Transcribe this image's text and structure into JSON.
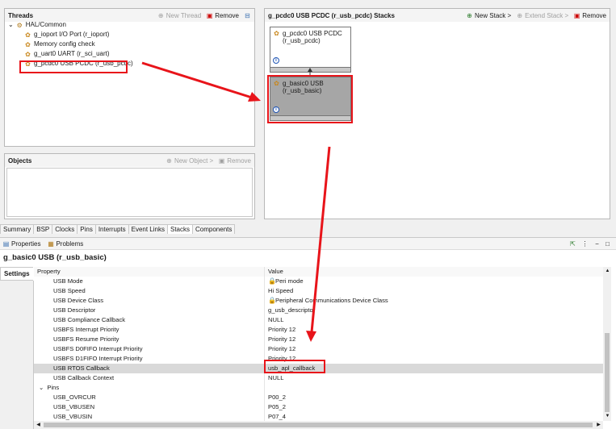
{
  "threads": {
    "title": "Threads",
    "new_thread": "New Thread",
    "remove": "Remove",
    "root": "HAL/Common",
    "items": [
      {
        "label": "g_ioport I/O Port (r_ioport)"
      },
      {
        "label": "Memory config check"
      },
      {
        "label": "g_uart0 UART (r_sci_uart)"
      },
      {
        "label": "g_pcdc0 USB PCDC (r_usb_pcdc)"
      }
    ]
  },
  "objects": {
    "title": "Objects",
    "new_object": "New Object >",
    "remove": "Remove"
  },
  "stacks": {
    "title": "g_pcdc0 USB PCDC (r_usb_pcdc) Stacks",
    "new_stack": "New Stack >",
    "extend_stack": "Extend Stack >",
    "remove": "Remove",
    "box1": {
      "line1": "g_pcdc0 USB PCDC",
      "line2": "(r_usb_pcdc)"
    },
    "box2": {
      "line1": "g_basic0 USB",
      "line2": "(r_usb_basic)"
    }
  },
  "tabs": [
    "Summary",
    "BSP",
    "Clocks",
    "Pins",
    "Interrupts",
    "Event Links",
    "Stacks",
    "Components"
  ],
  "active_tab": "Stacks",
  "bottom": {
    "properties_tab": "Properties",
    "problems_tab": "Problems",
    "title": "g_basic0 USB (r_usb_basic)",
    "settings_tab": "Settings",
    "col_property": "Property",
    "col_value": "Value",
    "rows": [
      {
        "name": "USB Mode",
        "value": "Peri mode",
        "lock": true
      },
      {
        "name": "USB Speed",
        "value": "Hi Speed"
      },
      {
        "name": "USB Device Class",
        "value": "Peripheral Communications Device Class",
        "lock": true
      },
      {
        "name": "USB Descriptor",
        "value": "g_usb_descriptor"
      },
      {
        "name": "USB Compliance Callback",
        "value": "NULL"
      },
      {
        "name": "USBFS Interrupt Priority",
        "value": "Priority 12"
      },
      {
        "name": "USBFS Resume Priority",
        "value": "Priority 12"
      },
      {
        "name": "USBFS D0FIFO Interrupt Priority",
        "value": "Priority 12"
      },
      {
        "name": "USBFS D1FIFO Interrupt Priority",
        "value": "Priority 12"
      },
      {
        "name": "USB RTOS Callback",
        "value": "usb_apl_callback",
        "selected": true
      },
      {
        "name": "USB Callback Context",
        "value": "NULL"
      },
      {
        "name": "Pins",
        "value": "",
        "group": true
      },
      {
        "name": "USB_OVRCUR",
        "value": "P00_2"
      },
      {
        "name": "USB_VBUSEN",
        "value": "P05_2"
      },
      {
        "name": "USB_VBUSIN",
        "value": "P07_4"
      }
    ]
  },
  "colors": {
    "highlight": "#e8141a",
    "arrow": "#e8141a",
    "selected_box": "#a6a6a6"
  }
}
